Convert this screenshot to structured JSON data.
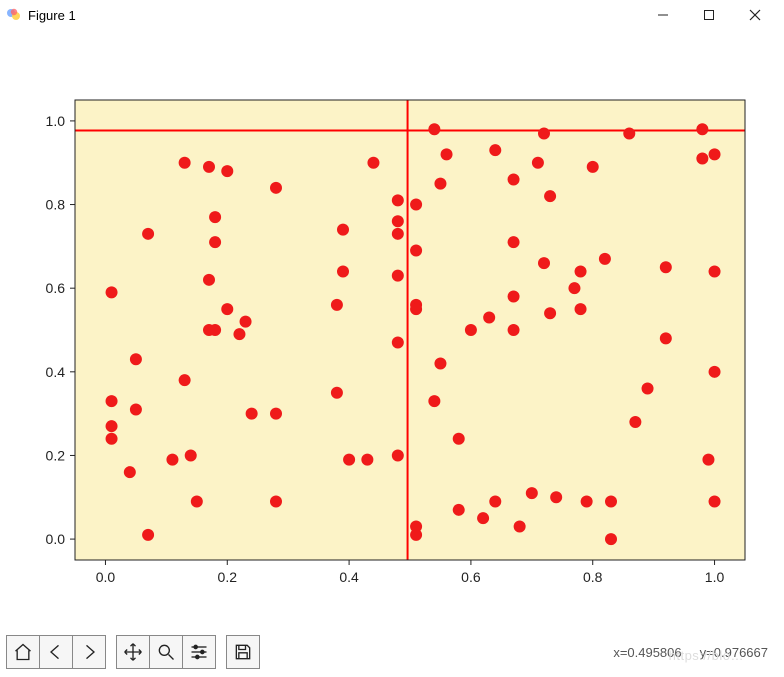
{
  "window": {
    "title": "Figure 1"
  },
  "coord_readout": "x=0.495806     y=0.976667",
  "watermark": "https://blo…",
  "toolbar": {
    "home": "home",
    "back": "back",
    "forward": "forward",
    "pan": "pan",
    "zoom": "zoom",
    "configure": "configure",
    "save": "save"
  },
  "chart_data": {
    "type": "scatter",
    "title": "",
    "xlabel": "",
    "ylabel": "",
    "xlim": [
      -0.05,
      1.05
    ],
    "ylim": [
      -0.05,
      1.05
    ],
    "xticks": [
      0.0,
      0.2,
      0.4,
      0.6,
      0.8,
      1.0
    ],
    "yticks": [
      0.0,
      0.2,
      0.4,
      0.6,
      0.8,
      1.0
    ],
    "face_color": "#fcf3c7",
    "point_color": "#ef1a1a",
    "point_radius": 6,
    "cursor": {
      "x": 0.496,
      "y": 0.977,
      "color": "#ff0000"
    },
    "points": [
      [
        0.01,
        0.33
      ],
      [
        0.01,
        0.27
      ],
      [
        0.01,
        0.24
      ],
      [
        0.01,
        0.59
      ],
      [
        0.04,
        0.16
      ],
      [
        0.05,
        0.43
      ],
      [
        0.05,
        0.31
      ],
      [
        0.07,
        0.73
      ],
      [
        0.07,
        0.01
      ],
      [
        0.11,
        0.19
      ],
      [
        0.13,
        0.9
      ],
      [
        0.13,
        0.38
      ],
      [
        0.14,
        0.2
      ],
      [
        0.15,
        0.09
      ],
      [
        0.17,
        0.89
      ],
      [
        0.17,
        0.62
      ],
      [
        0.17,
        0.5
      ],
      [
        0.18,
        0.77
      ],
      [
        0.18,
        0.71
      ],
      [
        0.18,
        0.5
      ],
      [
        0.2,
        0.88
      ],
      [
        0.2,
        0.55
      ],
      [
        0.22,
        0.49
      ],
      [
        0.23,
        0.52
      ],
      [
        0.24,
        0.3
      ],
      [
        0.28,
        0.84
      ],
      [
        0.28,
        0.3
      ],
      [
        0.28,
        0.09
      ],
      [
        0.38,
        0.56
      ],
      [
        0.38,
        0.35
      ],
      [
        0.39,
        0.74
      ],
      [
        0.39,
        0.64
      ],
      [
        0.4,
        0.19
      ],
      [
        0.43,
        0.19
      ],
      [
        0.44,
        0.9
      ],
      [
        0.48,
        0.81
      ],
      [
        0.48,
        0.76
      ],
      [
        0.48,
        0.73
      ],
      [
        0.48,
        0.63
      ],
      [
        0.48,
        0.2
      ],
      [
        0.48,
        0.47
      ],
      [
        0.51,
        0.8
      ],
      [
        0.51,
        0.69
      ],
      [
        0.51,
        0.56
      ],
      [
        0.51,
        0.55
      ],
      [
        0.51,
        0.01
      ],
      [
        0.51,
        0.03
      ],
      [
        0.54,
        0.98
      ],
      [
        0.54,
        0.33
      ],
      [
        0.55,
        0.85
      ],
      [
        0.55,
        0.42
      ],
      [
        0.56,
        0.92
      ],
      [
        0.58,
        0.07
      ],
      [
        0.58,
        0.24
      ],
      [
        0.6,
        0.5
      ],
      [
        0.62,
        0.05
      ],
      [
        0.63,
        0.53
      ],
      [
        0.64,
        0.93
      ],
      [
        0.64,
        0.09
      ],
      [
        0.67,
        0.86
      ],
      [
        0.67,
        0.71
      ],
      [
        0.67,
        0.58
      ],
      [
        0.67,
        0.5
      ],
      [
        0.68,
        0.03
      ],
      [
        0.7,
        0.11
      ],
      [
        0.71,
        0.9
      ],
      [
        0.72,
        0.97
      ],
      [
        0.72,
        0.66
      ],
      [
        0.73,
        0.82
      ],
      [
        0.73,
        0.54
      ],
      [
        0.74,
        0.1
      ],
      [
        0.77,
        0.6
      ],
      [
        0.78,
        0.64
      ],
      [
        0.78,
        0.55
      ],
      [
        0.79,
        0.09
      ],
      [
        0.8,
        0.89
      ],
      [
        0.82,
        0.67
      ],
      [
        0.83,
        0.09
      ],
      [
        0.83,
        0.0
      ],
      [
        0.86,
        0.97
      ],
      [
        0.87,
        0.28
      ],
      [
        0.89,
        0.36
      ],
      [
        0.92,
        0.65
      ],
      [
        0.92,
        0.48
      ],
      [
        0.98,
        0.98
      ],
      [
        0.98,
        0.91
      ],
      [
        0.99,
        0.19
      ],
      [
        1.0,
        0.92
      ],
      [
        1.0,
        0.64
      ],
      [
        1.0,
        0.4
      ],
      [
        1.0,
        0.09
      ]
    ]
  }
}
